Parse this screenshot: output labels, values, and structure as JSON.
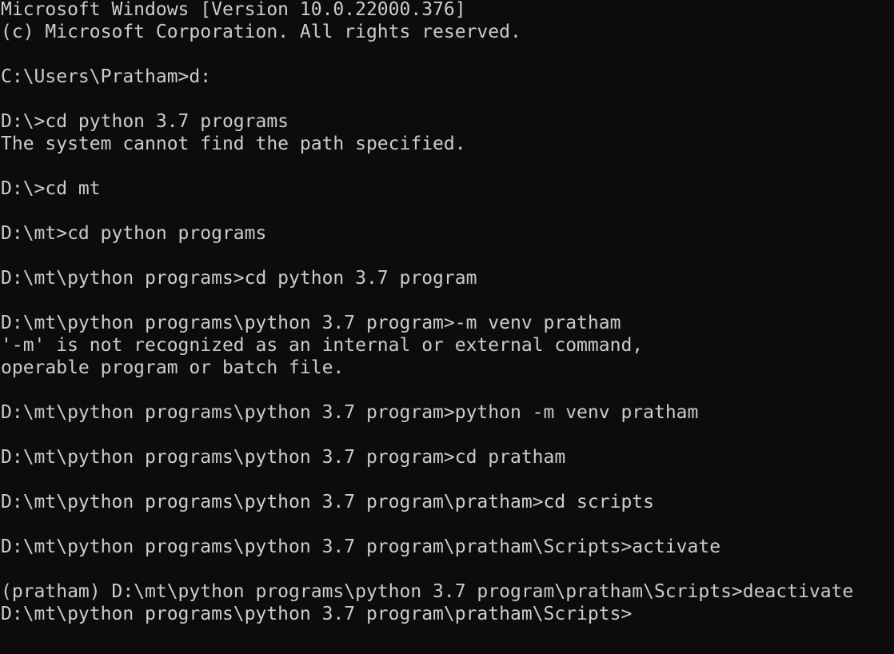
{
  "terminal": {
    "lines": [
      "Microsoft Windows [Version 10.0.22000.376]",
      "(c) Microsoft Corporation. All rights reserved.",
      "",
      "C:\\Users\\Pratham>d:",
      "",
      "D:\\>cd python 3.7 programs",
      "The system cannot find the path specified.",
      "",
      "D:\\>cd mt",
      "",
      "D:\\mt>cd python programs",
      "",
      "D:\\mt\\python programs>cd python 3.7 program",
      "",
      "D:\\mt\\python programs\\python 3.7 program>-m venv pratham",
      "'-m' is not recognized as an internal or external command,",
      "operable program or batch file.",
      "",
      "D:\\mt\\python programs\\python 3.7 program>python -m venv pratham",
      "",
      "D:\\mt\\python programs\\python 3.7 program>cd pratham",
      "",
      "D:\\mt\\python programs\\python 3.7 program\\pratham>cd scripts",
      "",
      "D:\\mt\\python programs\\python 3.7 program\\pratham\\Scripts>activate",
      "",
      "(pratham) D:\\mt\\python programs\\python 3.7 program\\pratham\\Scripts>deactivate",
      "D:\\mt\\python programs\\python 3.7 program\\pratham\\Scripts>"
    ]
  }
}
